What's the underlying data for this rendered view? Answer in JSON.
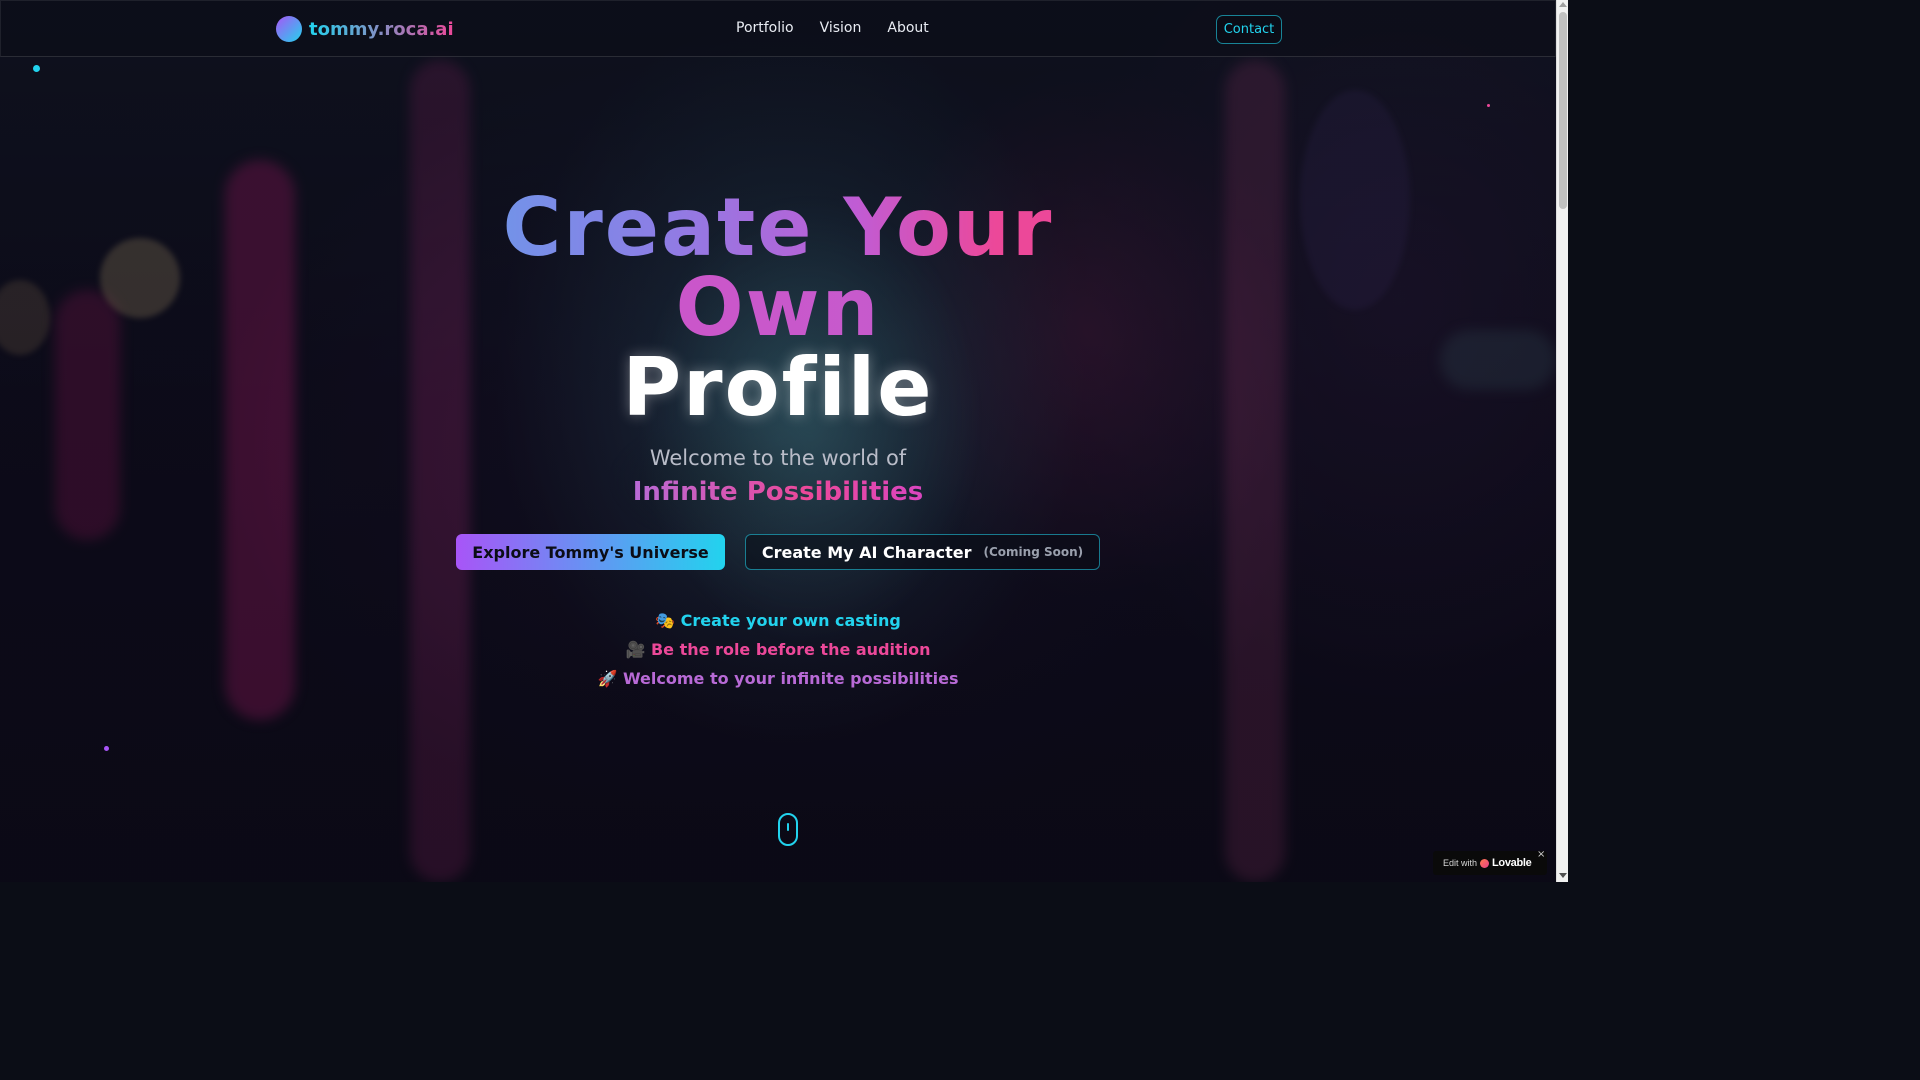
{
  "nav": {
    "logo_text": "tommy.roca.ai",
    "links": [
      "Portfolio",
      "Vision",
      "About"
    ],
    "contact_label": "Contact"
  },
  "hero": {
    "title_line1": "Create Your",
    "title_line2": "Own",
    "title_line3": "Profile",
    "welcome": "Welcome to the world of",
    "infinite": "Infinite Possibilities",
    "primary_button": "Explore Tommy's Universe",
    "secondary_button": "Create My AI Character",
    "secondary_tag": "(Coming Soon)",
    "features": [
      "🎭 Create your own casting",
      "🎥 Be the role before the audition",
      "🚀 Welcome to your infinite possibilities"
    ]
  },
  "badge": {
    "prefix": "Edit with",
    "name": "Lovable",
    "close": "×"
  },
  "colors": {
    "cyan": "#22d3ee",
    "pink": "#ec4899",
    "purple": "#a855f7"
  },
  "icons": {
    "scroll_indicator": "mouse-scroll-icon",
    "close": "close-icon"
  }
}
